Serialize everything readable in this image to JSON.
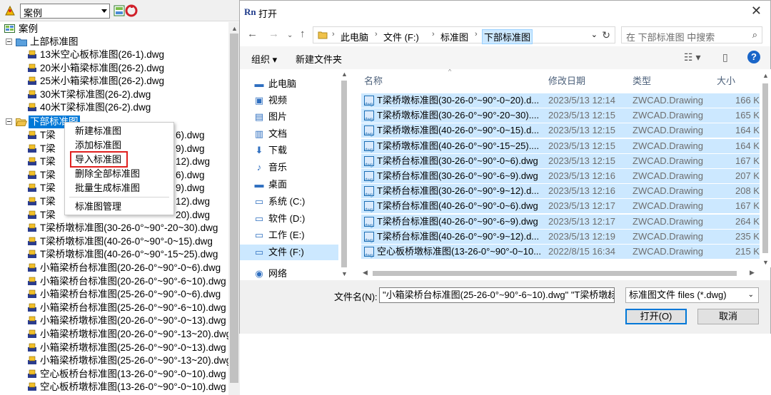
{
  "tree_panel": {
    "combo_value": "案例",
    "root_label": "案例",
    "groups": [
      {
        "label": "上部标准图",
        "items": [
          "13米空心板标准图(26-1).dwg",
          "20米小箱梁标准图(26-2).dwg",
          "25米小箱梁标准图(26-2).dwg",
          "30米T梁标准图(26-2).dwg",
          "40米T梁标准图(26-2).dwg"
        ]
      },
      {
        "label": "下部标准图",
        "items": [
          {
            "prefix": "T梁",
            "suffix": "6).dwg"
          },
          {
            "prefix": "T梁",
            "suffix": "9).dwg"
          },
          {
            "prefix": "T梁",
            "suffix": "12).dwg"
          },
          {
            "prefix": "T梁",
            "suffix": "6).dwg"
          },
          {
            "prefix": "T梁",
            "suffix": "9).dwg"
          },
          {
            "prefix": "T梁",
            "suffix": "12).dwg"
          },
          {
            "prefix": "T梁",
            "suffix": "20).dwg"
          },
          {
            "prefix": "",
            "suffix": "T梁桥墩标准图(30-26-0°~90°-20~30).dwg"
          },
          {
            "prefix": "",
            "suffix": "T梁桥墩标准图(40-26-0°~90°-0~15).dwg"
          },
          {
            "prefix": "",
            "suffix": "T梁桥墩标准图(40-26-0°~90°-15~25).dwg"
          },
          {
            "prefix": "",
            "suffix": "小箱梁桥台标准图(20-26-0°~90°-0~6).dwg"
          },
          {
            "prefix": "",
            "suffix": "小箱梁桥台标准图(20-26-0°~90°-6~10).dwg"
          },
          {
            "prefix": "",
            "suffix": "小箱梁桥台标准图(25-26-0°~90°-0~6).dwg"
          },
          {
            "prefix": "",
            "suffix": "小箱梁桥台标准图(25-26-0°~90°-6~10).dwg"
          },
          {
            "prefix": "",
            "suffix": "小箱梁桥墩标准图(20-26-0°~90°-0~13).dwg"
          },
          {
            "prefix": "",
            "suffix": "小箱梁桥墩标准图(20-26-0°~90°-13~20).dwg"
          },
          {
            "prefix": "",
            "suffix": "小箱梁桥墩标准图(25-26-0°~90°-0~13).dwg"
          },
          {
            "prefix": "",
            "suffix": "小箱梁桥墩标准图(25-26-0°~90°-13~20).dwg"
          },
          {
            "prefix": "",
            "suffix": "空心板桥台标准图(13-26-0°~90°-0~10).dwg"
          },
          {
            "prefix": "",
            "suffix": "空心板桥墩标准图(13-26-0°~90°-0~10).dwg"
          }
        ]
      }
    ],
    "context_menu": [
      "新建标准图",
      "添加标准图",
      "导入标准图",
      "删除全部标准图",
      "批量生成标准图",
      "标准图管理"
    ]
  },
  "dialog": {
    "title": "打开",
    "app_logo": "Rn",
    "breadcrumbs": [
      "此电脑",
      "文件 (F:)",
      "标准图",
      "下部标准图"
    ],
    "search_placeholder": "在 下部标准图 中搜索",
    "toolbar": {
      "organize": "组织 ▾",
      "new_folder": "新建文件夹"
    },
    "nav_items": [
      {
        "icon": "pc-icon",
        "glyph": "▬",
        "label": "此电脑"
      },
      {
        "icon": "video-icon",
        "glyph": "▣",
        "label": "视频"
      },
      {
        "icon": "picture-icon",
        "glyph": "▤",
        "label": "图片"
      },
      {
        "icon": "document-icon",
        "glyph": "▥",
        "label": "文档"
      },
      {
        "icon": "download-icon",
        "glyph": "⬇",
        "label": "下载"
      },
      {
        "icon": "music-icon",
        "glyph": "♪",
        "label": "音乐"
      },
      {
        "icon": "desktop-icon",
        "glyph": "▬",
        "label": "桌面"
      },
      {
        "icon": "drive-icon",
        "glyph": "▭",
        "label": "系统 (C:)"
      },
      {
        "icon": "drive-icon",
        "glyph": "▭",
        "label": "软件 (D:)"
      },
      {
        "icon": "drive-icon",
        "glyph": "▭",
        "label": "工作 (E:)"
      },
      {
        "icon": "drive-icon",
        "glyph": "▭",
        "label": "文件 (F:)"
      },
      {
        "icon": "network-icon",
        "glyph": "◉",
        "label": "网络"
      }
    ],
    "columns": {
      "name": "名称",
      "date": "修改日期",
      "type": "类型",
      "size": "大小"
    },
    "files": [
      {
        "name": "T梁桥墩标准图(30-26-0°~90°-0~20).d...",
        "date": "2023/5/13 12:14",
        "type": "ZWCAD.Drawing",
        "size": "166 K"
      },
      {
        "name": "T梁桥墩标准图(30-26-0°~90°-20~30)....",
        "date": "2023/5/13 12:15",
        "type": "ZWCAD.Drawing",
        "size": "165 K"
      },
      {
        "name": "T梁桥墩标准图(40-26-0°~90°-0~15).d...",
        "date": "2023/5/13 12:15",
        "type": "ZWCAD.Drawing",
        "size": "164 K"
      },
      {
        "name": "T梁桥墩标准图(40-26-0°~90°-15~25)....",
        "date": "2023/5/13 12:15",
        "type": "ZWCAD.Drawing",
        "size": "164 K"
      },
      {
        "name": "T梁桥台标准图(30-26-0°~90°-0~6).dwg",
        "date": "2023/5/13 12:15",
        "type": "ZWCAD.Drawing",
        "size": "167 K"
      },
      {
        "name": "T梁桥台标准图(30-26-0°~90°-6~9).dwg",
        "date": "2023/5/13 12:16",
        "type": "ZWCAD.Drawing",
        "size": "207 K"
      },
      {
        "name": "T梁桥台标准图(30-26-0°~90°-9~12).d...",
        "date": "2023/5/13 12:16",
        "type": "ZWCAD.Drawing",
        "size": "208 K"
      },
      {
        "name": "T梁桥台标准图(40-26-0°~90°-0~6).dwg",
        "date": "2023/5/13 12:17",
        "type": "ZWCAD.Drawing",
        "size": "167 K"
      },
      {
        "name": "T梁桥台标准图(40-26-0°~90°-6~9).dwg",
        "date": "2023/5/13 12:17",
        "type": "ZWCAD.Drawing",
        "size": "264 K"
      },
      {
        "name": "T梁桥台标准图(40-26-0°~90°-9~12).d...",
        "date": "2023/5/13 12:19",
        "type": "ZWCAD.Drawing",
        "size": "235 K"
      },
      {
        "name": "空心板桥墩标准图(13-26-0°~90°-0~10...",
        "date": "2022/8/15 16:34",
        "type": "ZWCAD.Drawing",
        "size": "215 K"
      }
    ],
    "filename_label": "文件名(N):",
    "filename_value": "\"小箱梁桥台标准图(25-26-0°~90°-6~10).dwg\" \"T梁桥墩标",
    "filetype_value": "标准图文件 files (*.dwg)",
    "open_button": "打开(O)",
    "cancel_button": "取消"
  }
}
